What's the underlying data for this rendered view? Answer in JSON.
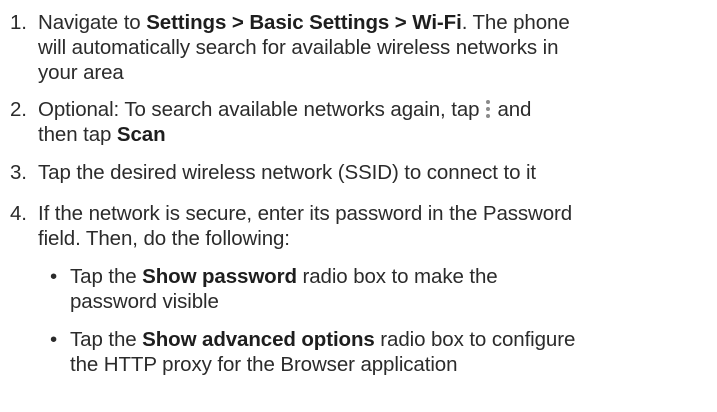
{
  "steps": [
    {
      "number": "1.",
      "line1_pre": "Navigate to ",
      "line1_bold": "Settings > Basic Settings > Wi-Fi",
      "line1_post": ". The phone",
      "line2": "will automatically search for available wireless networks in",
      "line3": "your area"
    },
    {
      "number": "2.",
      "line1_pre": "Optional: To search available networks again, tap",
      "line1_post": "and",
      "icon": "more-vertical-icon",
      "line2_pre": "then tap ",
      "line2_bold": "Scan"
    },
    {
      "number": "3.",
      "line1": "Tap the desired wireless network (SSID) to connect to it"
    },
    {
      "number": "4.",
      "line1": "If the network is secure, enter its password in the Password",
      "line2": "field. Then, do the following:"
    }
  ],
  "bullets": [
    {
      "marker": "•",
      "line1_pre": "Tap the ",
      "line1_bold": "Show password",
      "line1_post": " radio box to make the",
      "line2": "password visible"
    },
    {
      "marker": "•",
      "line1_pre": "Tap the ",
      "line1_bold": "Show advanced options",
      "line1_post": " radio box to configure",
      "line2": "the HTTP proxy for the Browser application"
    }
  ]
}
